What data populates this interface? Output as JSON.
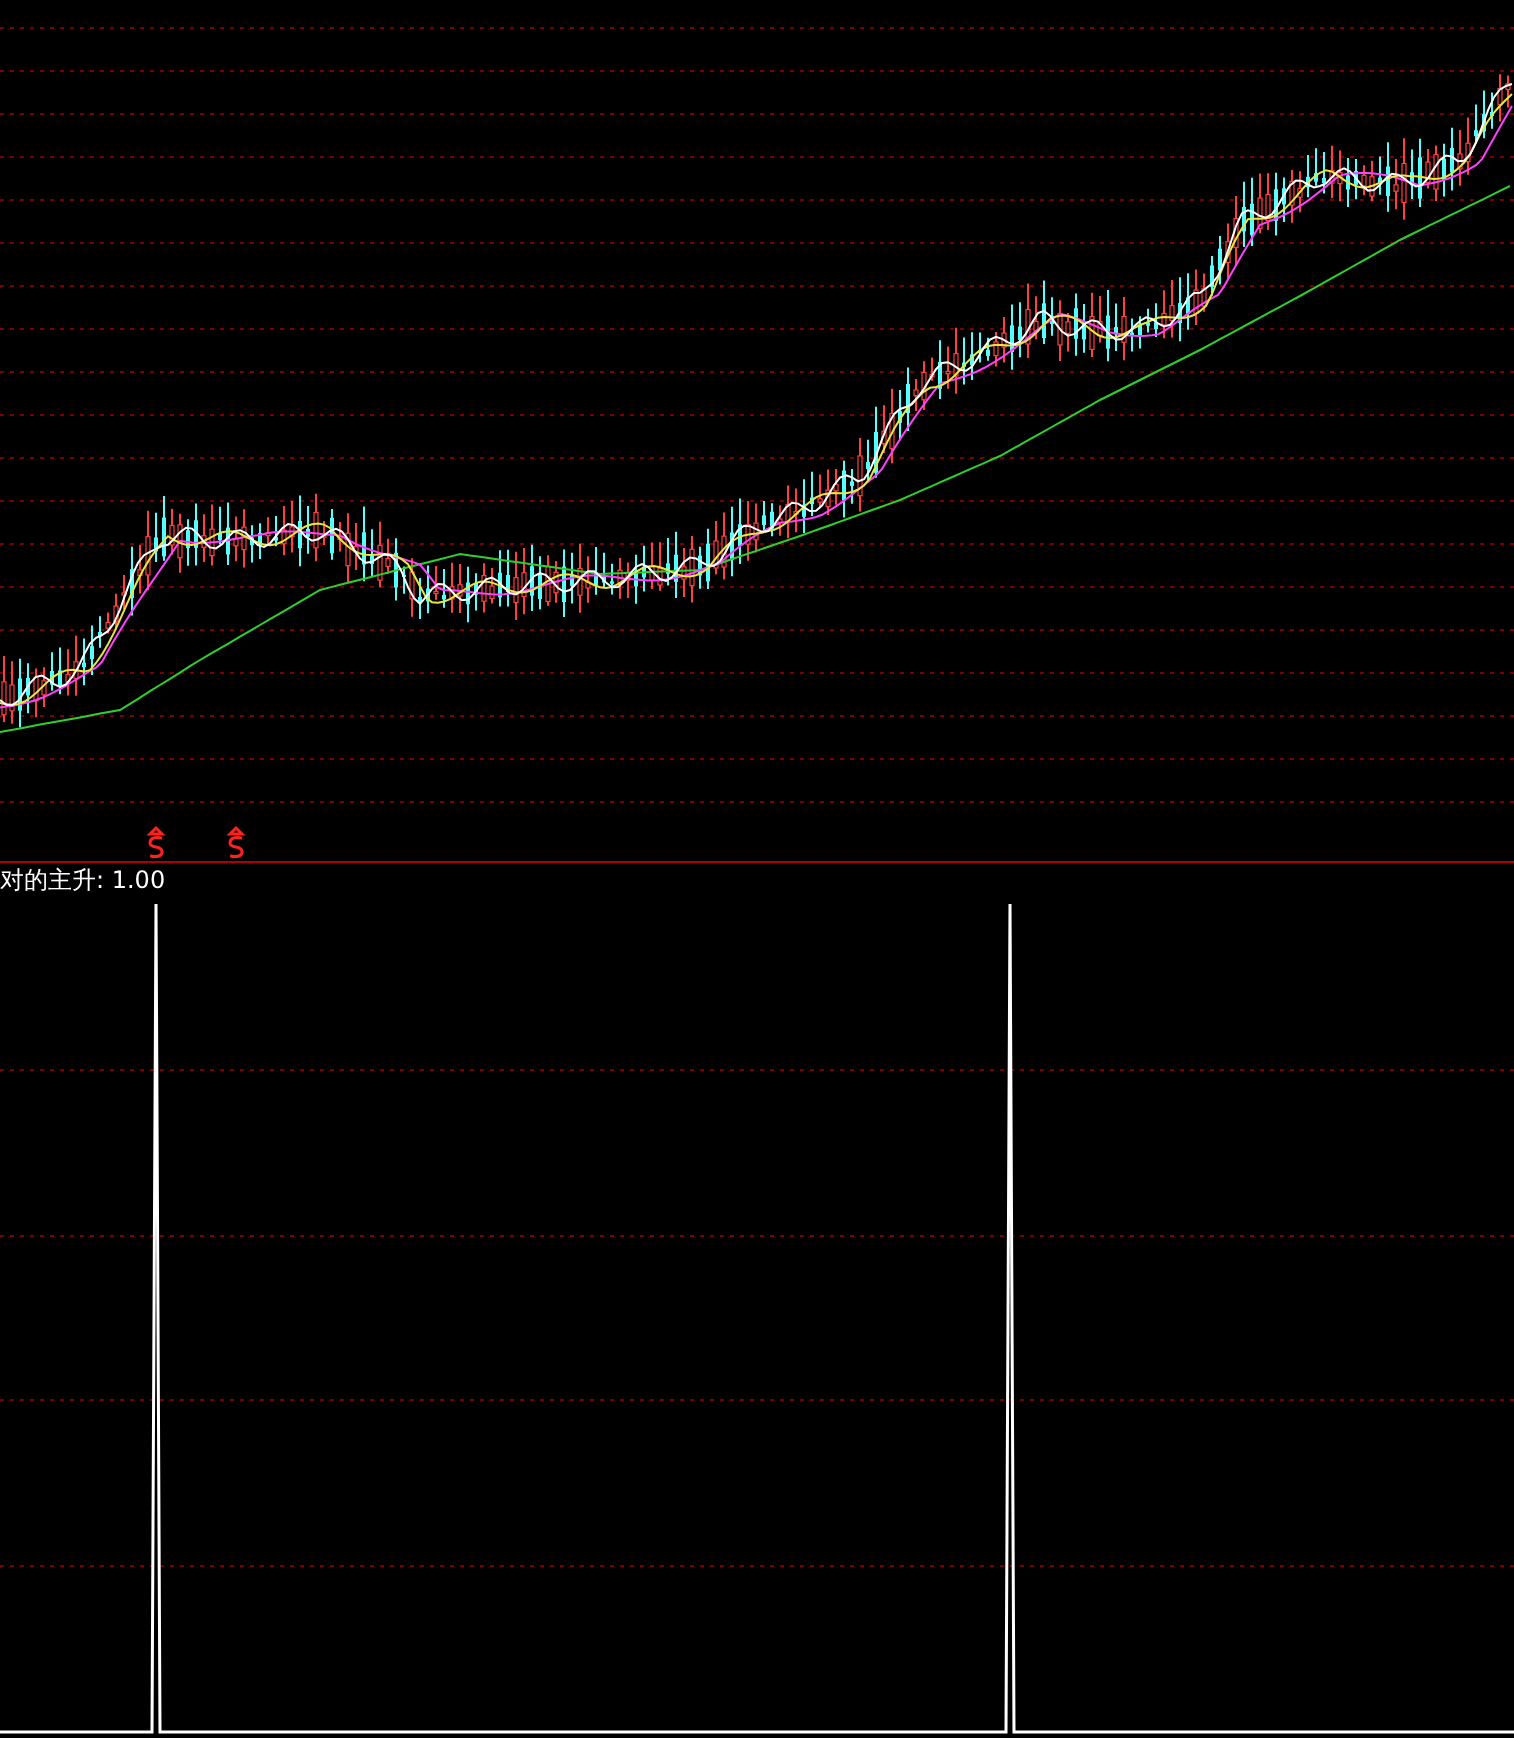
{
  "indicator": {
    "label": "对的主升: 1.00"
  }
}
